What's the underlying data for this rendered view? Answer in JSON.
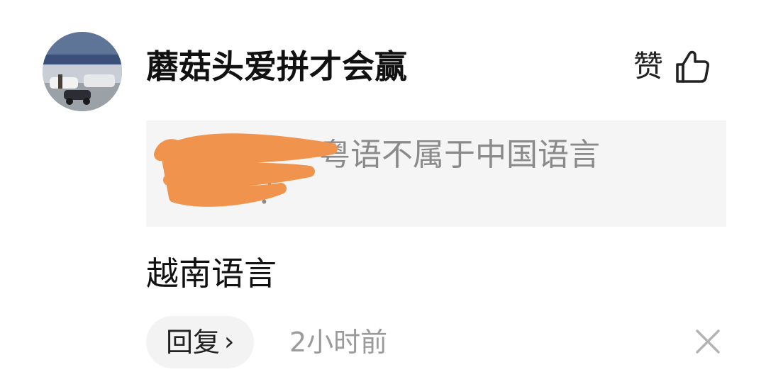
{
  "comment": {
    "username": "蘑菇头爱拼才会赢",
    "avatar_icon": "avatar-photo",
    "like_label": "赞",
    "like_icon": "thumbs-up-icon",
    "quote_visible_text": "粤语不属于中国语言",
    "quote_tail": "？？",
    "redaction_color": "#f0934d",
    "body": "越南语言",
    "reply_label": "回复",
    "reply_chevron": "›",
    "timestamp": "2小时前",
    "close_icon": "close-icon"
  }
}
